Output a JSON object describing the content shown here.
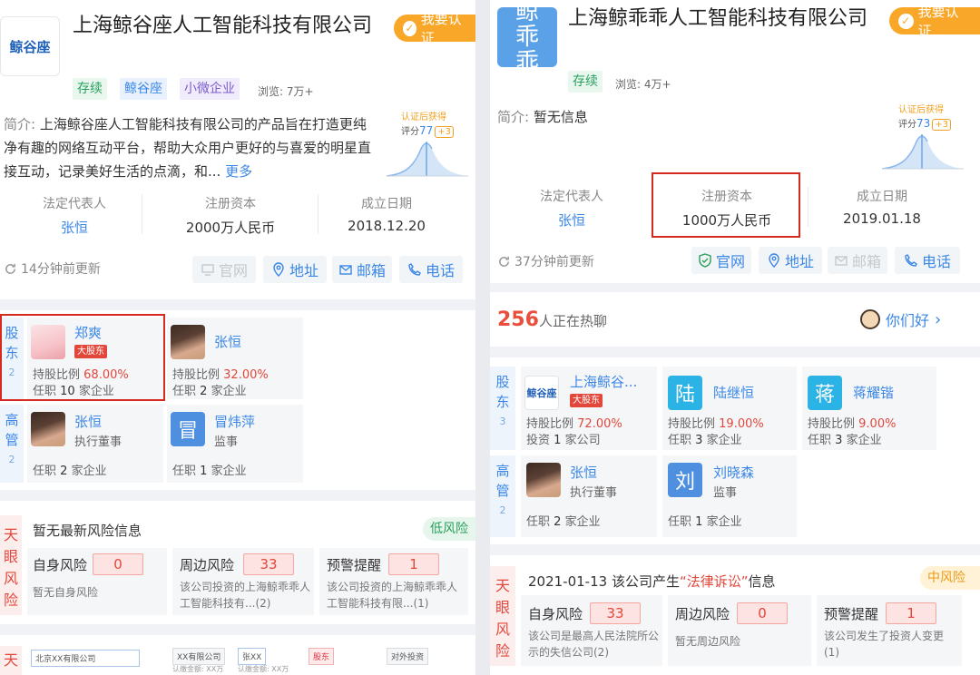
{
  "left": {
    "logo_text": "鲸谷座",
    "title": "上海鲸谷座人工智能科技有限公司",
    "verify_label": "我要认证",
    "tags": [
      "存续",
      "鲸谷座",
      "小微企业"
    ],
    "views": "浏览: 7万+",
    "intro_label": "简介:",
    "intro_text": "上海鲸谷座人工智能科技有限公司的产品旨在打造更纯净有趣的网络互动平台，帮助大众用户更好的与喜爱的明星直接互动，记录美好生活的点滴，和...",
    "more_label": "更多",
    "score": {
      "title": "认证后获得",
      "label": "评分",
      "value": "77",
      "plus": "+3"
    },
    "info": [
      {
        "key": "法定代表人",
        "value": "张恒"
      },
      {
        "key": "注册资本",
        "value": "2000万人民币"
      },
      {
        "key": "成立日期",
        "value": "2018.12.20"
      }
    ],
    "updated": "14分钟前更新",
    "links": [
      "官网",
      "地址",
      "邮箱",
      "电话"
    ],
    "shareholder_label": {
      "text": "股东",
      "count": "2"
    },
    "exec_label": {
      "text": "高管",
      "count": "2"
    },
    "shareholders": [
      {
        "name": "郑爽",
        "badge": "大股东",
        "ratio_label": "持股比例",
        "ratio": "68.00%",
        "work_pre": "任职",
        "work_num": "10",
        "work_post": "家企业"
      },
      {
        "name": "张恒",
        "ratio_label": "持股比例",
        "ratio": "32.00%",
        "work_pre": "任职",
        "work_num": "2",
        "work_post": "家企业"
      }
    ],
    "executives": [
      {
        "name": "张恒",
        "role": "执行董事",
        "work_pre": "任职",
        "work_num": "2",
        "work_post": "家企业"
      },
      {
        "name": "冒炜萍",
        "avatar_char": "冒",
        "role": "监事",
        "work_pre": "任职",
        "work_num": "1",
        "work_post": "家企业"
      }
    ],
    "risk_label": "天眼风险",
    "risk_head": "暂无最新风险信息",
    "risk_level": "低风险",
    "risks": [
      {
        "title": "自身风险",
        "count": "0",
        "desc": "暂无自身风险"
      },
      {
        "title": "周边风险",
        "count": "33",
        "desc": "该公司投资的上海鲸乖乖人工智能科技有...(2)"
      },
      {
        "title": "预警提醒",
        "count": "1",
        "desc": "该公司投资的上海鲸乖乖人工智能科技有限...(1)"
      }
    ],
    "bottom_label": "天",
    "diagram": {
      "company": "北京XX有限公司",
      "a": "XX有限公司",
      "b": "张XX",
      "c": "股东",
      "d": "对外投资",
      "e": "认缴金额: XX万",
      "f": "认缴金额: XX万"
    }
  },
  "right": {
    "logo_text": "鲸乖乖",
    "title": "上海鲸乖乖人工智能科技有限公司",
    "verify_label": "我要认证",
    "tags": [
      "存续"
    ],
    "views": "浏览: 4万+",
    "intro_label": "简介:",
    "intro_text": "暂无信息",
    "score": {
      "title": "认证后获得",
      "label": "评分",
      "value": "73",
      "plus": "+3"
    },
    "info": [
      {
        "key": "法定代表人",
        "value": "张恒"
      },
      {
        "key": "注册资本",
        "value": "1000万人民币"
      },
      {
        "key": "成立日期",
        "value": "2019.01.18"
      }
    ],
    "updated": "37分钟前更新",
    "links": [
      "官网",
      "地址",
      "邮箱",
      "电话"
    ],
    "hot_count": "256",
    "hot_text": "人正在热聊",
    "hello": "你们好",
    "shareholder_label": {
      "text": "股东",
      "count": "3"
    },
    "exec_label": {
      "text": "高管",
      "count": "2"
    },
    "shareholders": [
      {
        "name": "上海鲸谷...",
        "logo": "鲸谷座",
        "badge": "大股东",
        "ratio_label": "持股比例",
        "ratio": "72.00%",
        "work_pre": "投资",
        "work_num": "1",
        "work_post": "家公司"
      },
      {
        "name": "陆继恒",
        "avatar_char": "陆",
        "ratio_label": "持股比例",
        "ratio": "19.00%",
        "work_pre": "任职",
        "work_num": "3",
        "work_post": "家企业"
      },
      {
        "name": "蒋耀锴",
        "avatar_char": "蒋",
        "ratio_label": "持股比例",
        "ratio": "9.00%",
        "work_pre": "任职",
        "work_num": "3",
        "work_post": "家企业"
      }
    ],
    "executives": [
      {
        "name": "张恒",
        "role": "执行董事",
        "work_pre": "任职",
        "work_num": "2",
        "work_post": "家企业"
      },
      {
        "name": "刘晓森",
        "avatar_char": "刘",
        "role": "监事",
        "work_pre": "任职",
        "work_num": "1",
        "work_post": "家企业"
      }
    ],
    "risk_label": "天眼风险",
    "risk_head_date": "2021-01-13 该公司产生",
    "risk_head_hl": "“法律诉讼”",
    "risk_head_post": "信息",
    "risk_level": "中风险",
    "risks": [
      {
        "title": "自身风险",
        "count": "33",
        "desc": "该公司是最高人民法院所公示的失信公司(2)"
      },
      {
        "title": "周边风险",
        "count": "0",
        "desc": "暂无周边风险"
      },
      {
        "title": "预警提醒",
        "count": "1",
        "desc": "该公司发生了投资人变更(1)"
      }
    ]
  }
}
